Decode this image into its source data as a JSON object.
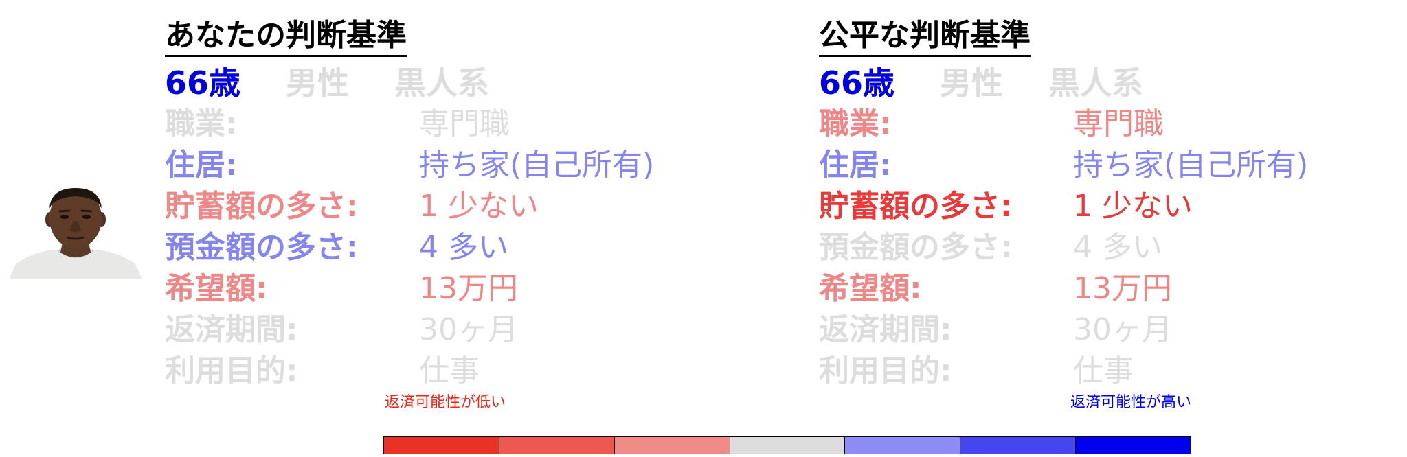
{
  "colors": {
    "blue_strong": "#0000dd",
    "blue_mid": "#8080ee",
    "red_strong": "#e83a3a",
    "red_mid": "#ee8888",
    "gray": "#dddddd"
  },
  "left": {
    "title": "あなたの判断基準",
    "demo": [
      {
        "text": "66歳",
        "color": "#0000dd"
      },
      {
        "text": "男性",
        "color": "#dddddd"
      },
      {
        "text": "黒人系",
        "color": "#dddddd"
      }
    ],
    "rows": [
      {
        "label": "職業:",
        "value": "専門職",
        "color": "#dddddd"
      },
      {
        "label": "住居:",
        "value": "持ち家(自己所有)",
        "color": "#8585ee"
      },
      {
        "label": "貯蓄額の多さ:",
        "value": "1 少ない",
        "color": "#ee8888"
      },
      {
        "label": "預金額の多さ:",
        "value": "4 多い",
        "color": "#8585ee"
      },
      {
        "label": "希望額:",
        "value": "13万円",
        "color": "#ee8888"
      },
      {
        "label": "返済期間:",
        "value": "30ヶ月",
        "color": "#dddddd"
      },
      {
        "label": "利用目的:",
        "value": "仕事",
        "color": "#dddddd"
      }
    ]
  },
  "right": {
    "title": "公平な判断基準",
    "demo": [
      {
        "text": "66歳",
        "color": "#0000dd"
      },
      {
        "text": "男性",
        "color": "#dddddd"
      },
      {
        "text": "黒人系",
        "color": "#dddddd"
      }
    ],
    "rows": [
      {
        "label": "職業:",
        "value": "専門職",
        "color": "#ee8888"
      },
      {
        "label": "住居:",
        "value": "持ち家(自己所有)",
        "color": "#8585ee"
      },
      {
        "label": "貯蓄額の多さ:",
        "value": "1 少ない",
        "color": "#e83a3a"
      },
      {
        "label": "預金額の多さ:",
        "value": "4 多い",
        "color": "#dddddd"
      },
      {
        "label": "希望額:",
        "value": "13万円",
        "color": "#ee8888"
      },
      {
        "label": "返済期間:",
        "value": "30ヶ月",
        "color": "#dddddd"
      },
      {
        "label": "利用目的:",
        "value": "仕事",
        "color": "#dddddd"
      }
    ]
  },
  "legend": {
    "low_label": "返済可能性が低い",
    "high_label": "返済可能性が高い",
    "segments": [
      "#e83224",
      "#ee5850",
      "#f08c88",
      "#dddddd",
      "#8c8cf4",
      "#4646f0",
      "#0000ee"
    ]
  }
}
